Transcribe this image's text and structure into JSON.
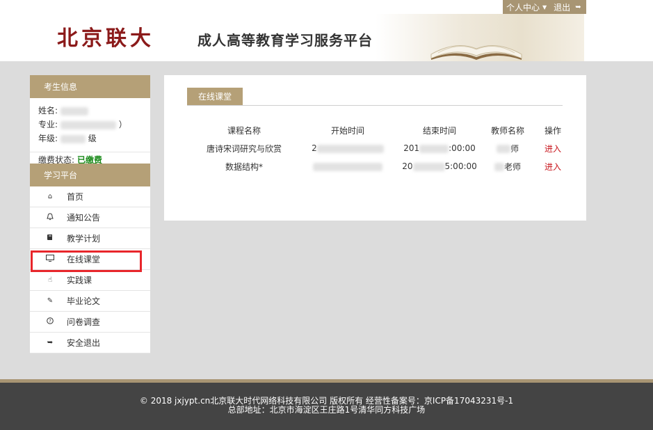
{
  "header": {
    "logo_text": "北京联大",
    "platform_title": "成人高等教育学习服务平台",
    "personal_center": "个人中心",
    "logout": "退出"
  },
  "sidebar": {
    "student_info_title": "考生信息",
    "name_label": "姓名:",
    "major_label": "专业:",
    "grade_label": "年级:",
    "grade_suffix": "级",
    "major_tail": "）",
    "fee_label": "缴费状态:",
    "fee_value": "已缴费",
    "learning_title": "学习平台",
    "nav": [
      {
        "label": "首页",
        "icon": "home-icon"
      },
      {
        "label": "通知公告",
        "icon": "bell-icon"
      },
      {
        "label": "教学计划",
        "icon": "book-icon"
      },
      {
        "label": "在线课堂",
        "icon": "monitor-icon"
      },
      {
        "label": "实践课",
        "icon": "hand-icon"
      },
      {
        "label": "毕业论文",
        "icon": "edit-icon"
      },
      {
        "label": "问卷调查",
        "icon": "question-icon"
      },
      {
        "label": "安全退出",
        "icon": "signout-icon"
      }
    ]
  },
  "main": {
    "tab_label": "在线课堂",
    "columns": [
      "课程名称",
      "开始时间",
      "结束时间",
      "教师名称",
      "操作"
    ],
    "rows": [
      {
        "course": "唐诗宋词研究与欣赏",
        "start_prefix": "2",
        "end_prefix": "201",
        "end_suffix": ":00:00",
        "teacher_suffix": "师",
        "action": "进入"
      },
      {
        "course": "数据结构*",
        "start_prefix": "",
        "end_prefix": "20",
        "end_suffix": "5:00:00",
        "teacher_suffix": "老师",
        "action": "进入"
      }
    ]
  },
  "footer": {
    "line1": "© 2018 jxjypt.cn北京联大时代网络科技有限公司 版权所有 经营性备案号：京ICP备17043231号-1",
    "line2": "总部地址：北京市海淀区王庄路1号清华同方科技广场"
  },
  "colors": {
    "accent": "#b5a077",
    "logo": "#8b1a1a",
    "paid": "#1a8a1a",
    "enter_link": "#c8161d",
    "highlight_box": "#e8262b",
    "footer_bg": "#444444"
  }
}
